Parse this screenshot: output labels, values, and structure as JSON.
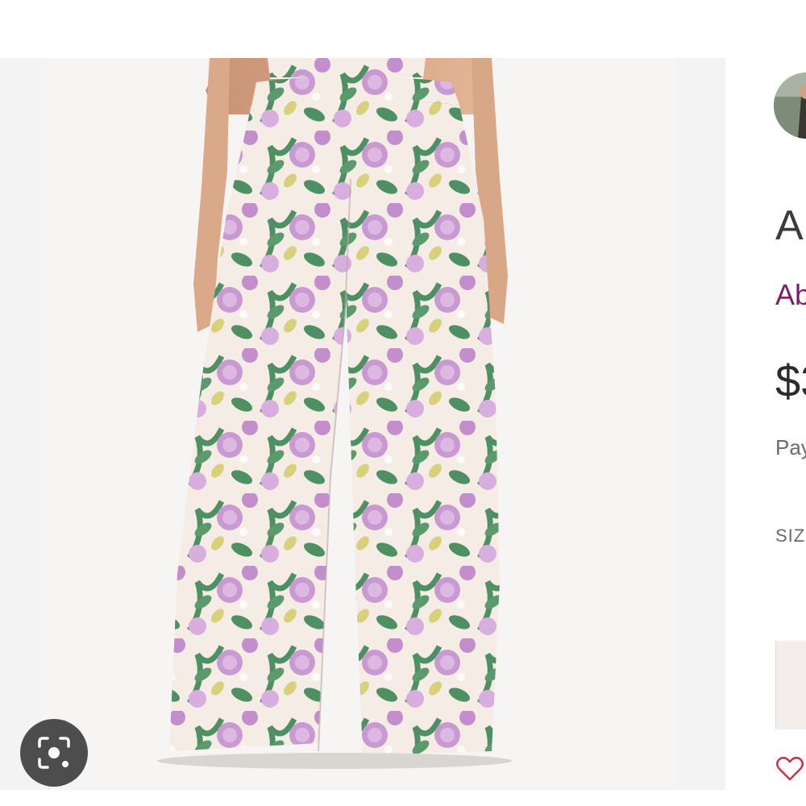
{
  "product": {
    "title": "A",
    "brand": "Ab",
    "price": "$3",
    "payment_note": "Pay",
    "size_label": "SIZ"
  },
  "icons": {
    "visual_search": "lens-camera-icon",
    "like": "heart-outline-icon"
  },
  "colors": {
    "brand_link": "#7a1f6e",
    "heart": "#c8324a",
    "fabric_base": "#f6ece6",
    "leaf": "#4e8f63",
    "flower": "#c99ad2"
  }
}
